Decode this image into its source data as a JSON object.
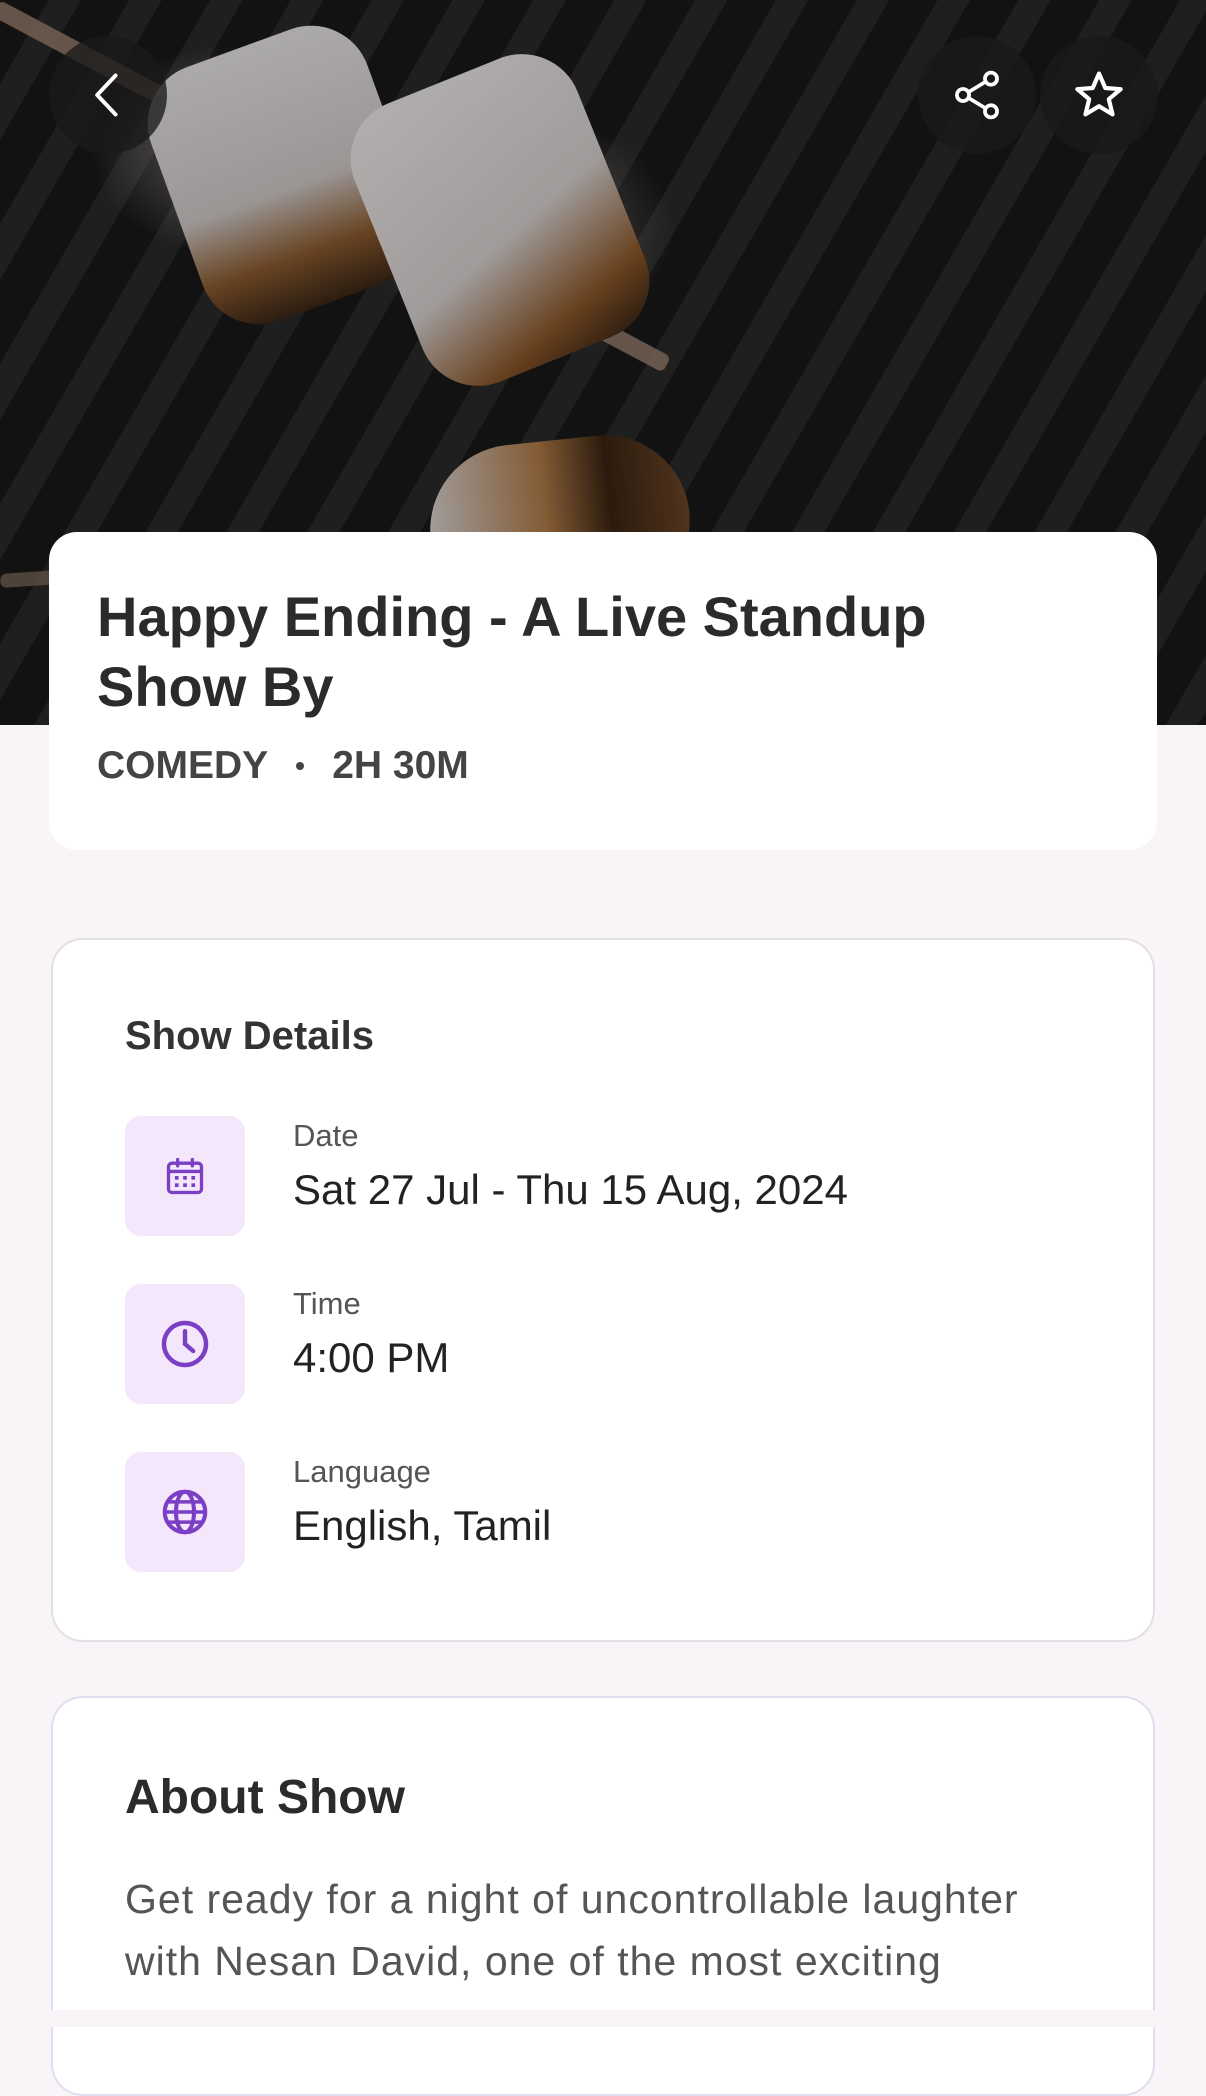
{
  "hero": {
    "back_icon": "chevron-left-icon",
    "share_icon": "share-icon",
    "favorite_icon": "star-outline-icon"
  },
  "show": {
    "title": "Happy Ending - A Live Standup Show By",
    "category": "COMEDY",
    "duration": "2H 30M"
  },
  "details": {
    "heading": "Show Details",
    "rows": [
      {
        "icon": "calendar-icon",
        "label": "Date",
        "value": "Sat 27 Jul - Thu 15 Aug, 2024"
      },
      {
        "icon": "clock-icon",
        "label": "Time",
        "value": "4:00 PM"
      },
      {
        "icon": "globe-icon",
        "label": "Language",
        "value": "English, Tamil"
      }
    ]
  },
  "about": {
    "heading": "About Show",
    "text": "Get ready for a night of uncontrollable laughter with Nesan David, one of the most exciting"
  },
  "colors": {
    "accent": "#7a3fc4",
    "icon_bg": "#f4e6fb",
    "page_bg": "#f8f4f8"
  }
}
